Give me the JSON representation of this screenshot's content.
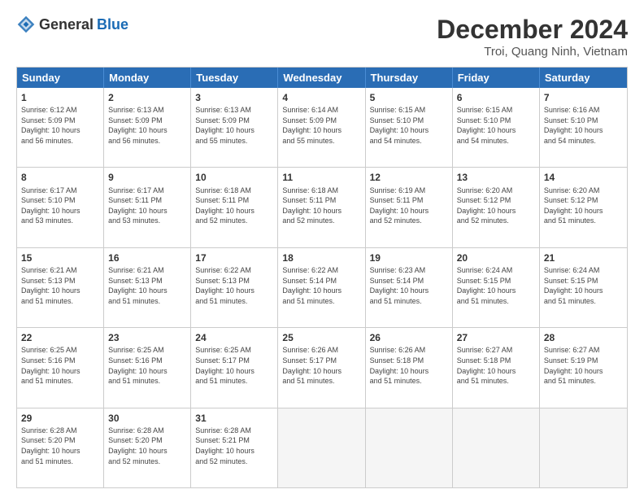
{
  "header": {
    "logo_general": "General",
    "logo_blue": "Blue",
    "month_title": "December 2024",
    "location": "Troi, Quang Ninh, Vietnam"
  },
  "days_of_week": [
    "Sunday",
    "Monday",
    "Tuesday",
    "Wednesday",
    "Thursday",
    "Friday",
    "Saturday"
  ],
  "weeks": [
    [
      {
        "day": "1",
        "info": "Sunrise: 6:12 AM\nSunset: 5:09 PM\nDaylight: 10 hours\nand 56 minutes."
      },
      {
        "day": "2",
        "info": "Sunrise: 6:13 AM\nSunset: 5:09 PM\nDaylight: 10 hours\nand 56 minutes."
      },
      {
        "day": "3",
        "info": "Sunrise: 6:13 AM\nSunset: 5:09 PM\nDaylight: 10 hours\nand 55 minutes."
      },
      {
        "day": "4",
        "info": "Sunrise: 6:14 AM\nSunset: 5:09 PM\nDaylight: 10 hours\nand 55 minutes."
      },
      {
        "day": "5",
        "info": "Sunrise: 6:15 AM\nSunset: 5:10 PM\nDaylight: 10 hours\nand 54 minutes."
      },
      {
        "day": "6",
        "info": "Sunrise: 6:15 AM\nSunset: 5:10 PM\nDaylight: 10 hours\nand 54 minutes."
      },
      {
        "day": "7",
        "info": "Sunrise: 6:16 AM\nSunset: 5:10 PM\nDaylight: 10 hours\nand 54 minutes."
      }
    ],
    [
      {
        "day": "8",
        "info": "Sunrise: 6:17 AM\nSunset: 5:10 PM\nDaylight: 10 hours\nand 53 minutes."
      },
      {
        "day": "9",
        "info": "Sunrise: 6:17 AM\nSunset: 5:11 PM\nDaylight: 10 hours\nand 53 minutes."
      },
      {
        "day": "10",
        "info": "Sunrise: 6:18 AM\nSunset: 5:11 PM\nDaylight: 10 hours\nand 52 minutes."
      },
      {
        "day": "11",
        "info": "Sunrise: 6:18 AM\nSunset: 5:11 PM\nDaylight: 10 hours\nand 52 minutes."
      },
      {
        "day": "12",
        "info": "Sunrise: 6:19 AM\nSunset: 5:11 PM\nDaylight: 10 hours\nand 52 minutes."
      },
      {
        "day": "13",
        "info": "Sunrise: 6:20 AM\nSunset: 5:12 PM\nDaylight: 10 hours\nand 52 minutes."
      },
      {
        "day": "14",
        "info": "Sunrise: 6:20 AM\nSunset: 5:12 PM\nDaylight: 10 hours\nand 51 minutes."
      }
    ],
    [
      {
        "day": "15",
        "info": "Sunrise: 6:21 AM\nSunset: 5:13 PM\nDaylight: 10 hours\nand 51 minutes."
      },
      {
        "day": "16",
        "info": "Sunrise: 6:21 AM\nSunset: 5:13 PM\nDaylight: 10 hours\nand 51 minutes."
      },
      {
        "day": "17",
        "info": "Sunrise: 6:22 AM\nSunset: 5:13 PM\nDaylight: 10 hours\nand 51 minutes."
      },
      {
        "day": "18",
        "info": "Sunrise: 6:22 AM\nSunset: 5:14 PM\nDaylight: 10 hours\nand 51 minutes."
      },
      {
        "day": "19",
        "info": "Sunrise: 6:23 AM\nSunset: 5:14 PM\nDaylight: 10 hours\nand 51 minutes."
      },
      {
        "day": "20",
        "info": "Sunrise: 6:24 AM\nSunset: 5:15 PM\nDaylight: 10 hours\nand 51 minutes."
      },
      {
        "day": "21",
        "info": "Sunrise: 6:24 AM\nSunset: 5:15 PM\nDaylight: 10 hours\nand 51 minutes."
      }
    ],
    [
      {
        "day": "22",
        "info": "Sunrise: 6:25 AM\nSunset: 5:16 PM\nDaylight: 10 hours\nand 51 minutes."
      },
      {
        "day": "23",
        "info": "Sunrise: 6:25 AM\nSunset: 5:16 PM\nDaylight: 10 hours\nand 51 minutes."
      },
      {
        "day": "24",
        "info": "Sunrise: 6:25 AM\nSunset: 5:17 PM\nDaylight: 10 hours\nand 51 minutes."
      },
      {
        "day": "25",
        "info": "Sunrise: 6:26 AM\nSunset: 5:17 PM\nDaylight: 10 hours\nand 51 minutes."
      },
      {
        "day": "26",
        "info": "Sunrise: 6:26 AM\nSunset: 5:18 PM\nDaylight: 10 hours\nand 51 minutes."
      },
      {
        "day": "27",
        "info": "Sunrise: 6:27 AM\nSunset: 5:18 PM\nDaylight: 10 hours\nand 51 minutes."
      },
      {
        "day": "28",
        "info": "Sunrise: 6:27 AM\nSunset: 5:19 PM\nDaylight: 10 hours\nand 51 minutes."
      }
    ],
    [
      {
        "day": "29",
        "info": "Sunrise: 6:28 AM\nSunset: 5:20 PM\nDaylight: 10 hours\nand 51 minutes."
      },
      {
        "day": "30",
        "info": "Sunrise: 6:28 AM\nSunset: 5:20 PM\nDaylight: 10 hours\nand 52 minutes."
      },
      {
        "day": "31",
        "info": "Sunrise: 6:28 AM\nSunset: 5:21 PM\nDaylight: 10 hours\nand 52 minutes."
      },
      {
        "day": "",
        "info": ""
      },
      {
        "day": "",
        "info": ""
      },
      {
        "day": "",
        "info": ""
      },
      {
        "day": "",
        "info": ""
      }
    ]
  ]
}
